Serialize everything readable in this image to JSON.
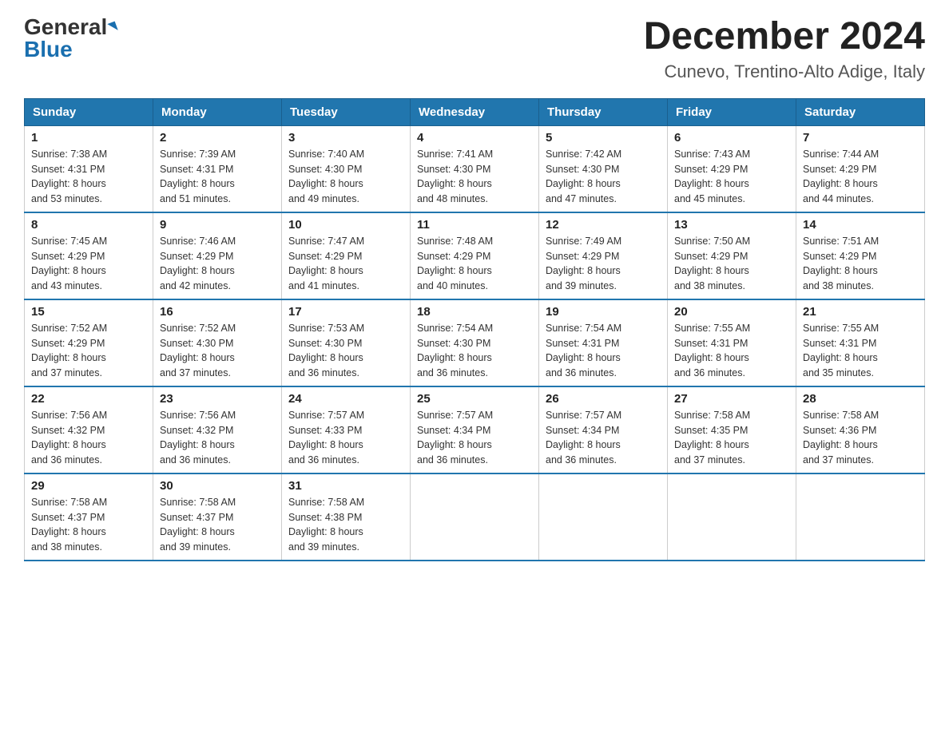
{
  "header": {
    "logo_general": "General",
    "logo_blue": "Blue",
    "month_title": "December 2024",
    "location": "Cunevo, Trentino-Alto Adige, Italy"
  },
  "days_of_week": [
    "Sunday",
    "Monday",
    "Tuesday",
    "Wednesday",
    "Thursday",
    "Friday",
    "Saturday"
  ],
  "weeks": [
    [
      {
        "day": "1",
        "sunrise": "7:38 AM",
        "sunset": "4:31 PM",
        "daylight": "8 hours and 53 minutes."
      },
      {
        "day": "2",
        "sunrise": "7:39 AM",
        "sunset": "4:31 PM",
        "daylight": "8 hours and 51 minutes."
      },
      {
        "day": "3",
        "sunrise": "7:40 AM",
        "sunset": "4:30 PM",
        "daylight": "8 hours and 49 minutes."
      },
      {
        "day": "4",
        "sunrise": "7:41 AM",
        "sunset": "4:30 PM",
        "daylight": "8 hours and 48 minutes."
      },
      {
        "day": "5",
        "sunrise": "7:42 AM",
        "sunset": "4:30 PM",
        "daylight": "8 hours and 47 minutes."
      },
      {
        "day": "6",
        "sunrise": "7:43 AM",
        "sunset": "4:29 PM",
        "daylight": "8 hours and 45 minutes."
      },
      {
        "day": "7",
        "sunrise": "7:44 AM",
        "sunset": "4:29 PM",
        "daylight": "8 hours and 44 minutes."
      }
    ],
    [
      {
        "day": "8",
        "sunrise": "7:45 AM",
        "sunset": "4:29 PM",
        "daylight": "8 hours and 43 minutes."
      },
      {
        "day": "9",
        "sunrise": "7:46 AM",
        "sunset": "4:29 PM",
        "daylight": "8 hours and 42 minutes."
      },
      {
        "day": "10",
        "sunrise": "7:47 AM",
        "sunset": "4:29 PM",
        "daylight": "8 hours and 41 minutes."
      },
      {
        "day": "11",
        "sunrise": "7:48 AM",
        "sunset": "4:29 PM",
        "daylight": "8 hours and 40 minutes."
      },
      {
        "day": "12",
        "sunrise": "7:49 AM",
        "sunset": "4:29 PM",
        "daylight": "8 hours and 39 minutes."
      },
      {
        "day": "13",
        "sunrise": "7:50 AM",
        "sunset": "4:29 PM",
        "daylight": "8 hours and 38 minutes."
      },
      {
        "day": "14",
        "sunrise": "7:51 AM",
        "sunset": "4:29 PM",
        "daylight": "8 hours and 38 minutes."
      }
    ],
    [
      {
        "day": "15",
        "sunrise": "7:52 AM",
        "sunset": "4:29 PM",
        "daylight": "8 hours and 37 minutes."
      },
      {
        "day": "16",
        "sunrise": "7:52 AM",
        "sunset": "4:30 PM",
        "daylight": "8 hours and 37 minutes."
      },
      {
        "day": "17",
        "sunrise": "7:53 AM",
        "sunset": "4:30 PM",
        "daylight": "8 hours and 36 minutes."
      },
      {
        "day": "18",
        "sunrise": "7:54 AM",
        "sunset": "4:30 PM",
        "daylight": "8 hours and 36 minutes."
      },
      {
        "day": "19",
        "sunrise": "7:54 AM",
        "sunset": "4:31 PM",
        "daylight": "8 hours and 36 minutes."
      },
      {
        "day": "20",
        "sunrise": "7:55 AM",
        "sunset": "4:31 PM",
        "daylight": "8 hours and 36 minutes."
      },
      {
        "day": "21",
        "sunrise": "7:55 AM",
        "sunset": "4:31 PM",
        "daylight": "8 hours and 35 minutes."
      }
    ],
    [
      {
        "day": "22",
        "sunrise": "7:56 AM",
        "sunset": "4:32 PM",
        "daylight": "8 hours and 36 minutes."
      },
      {
        "day": "23",
        "sunrise": "7:56 AM",
        "sunset": "4:32 PM",
        "daylight": "8 hours and 36 minutes."
      },
      {
        "day": "24",
        "sunrise": "7:57 AM",
        "sunset": "4:33 PM",
        "daylight": "8 hours and 36 minutes."
      },
      {
        "day": "25",
        "sunrise": "7:57 AM",
        "sunset": "4:34 PM",
        "daylight": "8 hours and 36 minutes."
      },
      {
        "day": "26",
        "sunrise": "7:57 AM",
        "sunset": "4:34 PM",
        "daylight": "8 hours and 36 minutes."
      },
      {
        "day": "27",
        "sunrise": "7:58 AM",
        "sunset": "4:35 PM",
        "daylight": "8 hours and 37 minutes."
      },
      {
        "day": "28",
        "sunrise": "7:58 AM",
        "sunset": "4:36 PM",
        "daylight": "8 hours and 37 minutes."
      }
    ],
    [
      {
        "day": "29",
        "sunrise": "7:58 AM",
        "sunset": "4:37 PM",
        "daylight": "8 hours and 38 minutes."
      },
      {
        "day": "30",
        "sunrise": "7:58 AM",
        "sunset": "4:37 PM",
        "daylight": "8 hours and 39 minutes."
      },
      {
        "day": "31",
        "sunrise": "7:58 AM",
        "sunset": "4:38 PM",
        "daylight": "8 hours and 39 minutes."
      },
      null,
      null,
      null,
      null
    ]
  ],
  "labels": {
    "sunrise_prefix": "Sunrise: ",
    "sunset_prefix": "Sunset: ",
    "daylight_prefix": "Daylight: "
  }
}
